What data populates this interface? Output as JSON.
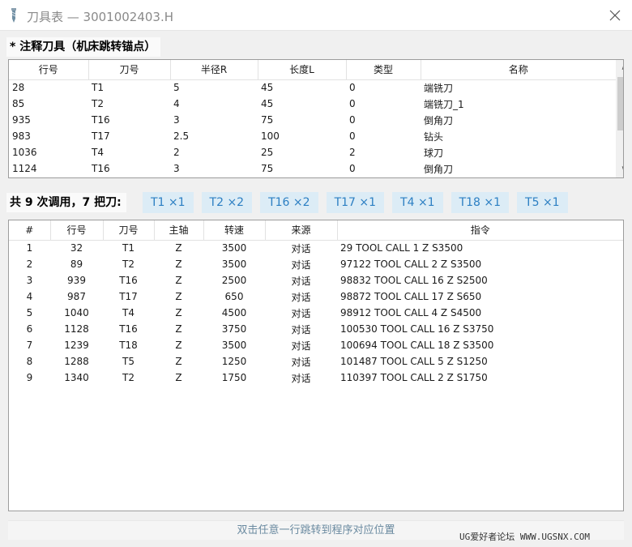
{
  "window": {
    "title": "刀具表 — 3001002403.H",
    "close_label": "×"
  },
  "annotated": {
    "label": "* 注释刀具（机床跳转锚点）",
    "columns": [
      "行号",
      "刀号",
      "半径R",
      "长度L",
      "类型",
      "名称"
    ],
    "rows": [
      [
        "28",
        "T1",
        "5",
        "45",
        "0",
        "端铣刀"
      ],
      [
        "85",
        "T2",
        "4",
        "45",
        "0",
        "端铣刀_1"
      ],
      [
        "935",
        "T16",
        "3",
        "75",
        "0",
        "倒角刀"
      ],
      [
        "983",
        "T17",
        "2.5",
        "100",
        "0",
        "钻头"
      ],
      [
        "1036",
        "T4",
        "2",
        "25",
        "2",
        "球刀"
      ],
      [
        "1124",
        "T16",
        "3",
        "75",
        "0",
        "倒角刀"
      ]
    ],
    "scroll_up": "∧",
    "scroll_down": "∨"
  },
  "summary": {
    "label": "共 9 次调用，7 把刀:",
    "chips": [
      "T1 ×1",
      "T2 ×2",
      "T16 ×2",
      "T17 ×1",
      "T4 ×1",
      "T18 ×1",
      "T5 ×1"
    ]
  },
  "calls": {
    "columns": [
      "#",
      "行号",
      "刀号",
      "主轴",
      "转速",
      "来源",
      "指令"
    ],
    "rows": [
      [
        "1",
        "32",
        "T1",
        "Z",
        "3500",
        "对话",
        "29 TOOL CALL 1 Z S3500"
      ],
      [
        "2",
        "89",
        "T2",
        "Z",
        "3500",
        "对话",
        "97122 TOOL CALL 2 Z S3500"
      ],
      [
        "3",
        "939",
        "T16",
        "Z",
        "2500",
        "对话",
        "98832 TOOL CALL 16 Z S2500"
      ],
      [
        "4",
        "987",
        "T17",
        "Z",
        "650",
        "对话",
        "98872 TOOL CALL 17 Z S650"
      ],
      [
        "5",
        "1040",
        "T4",
        "Z",
        "4500",
        "对话",
        "98912 TOOL CALL 4 Z S4500"
      ],
      [
        "6",
        "1128",
        "T16",
        "Z",
        "3750",
        "对话",
        "100530 TOOL CALL 16 Z S3750"
      ],
      [
        "7",
        "1239",
        "T18",
        "Z",
        "3500",
        "对话",
        "100694 TOOL CALL 18 Z S3500"
      ],
      [
        "8",
        "1288",
        "T5",
        "Z",
        "1250",
        "对话",
        "101487 TOOL CALL 5 Z S1250"
      ],
      [
        "9",
        "1340",
        "T2",
        "Z",
        "1750",
        "对话",
        "110397 TOOL CALL 2 Z S1750"
      ]
    ]
  },
  "status": {
    "hint": "双击任意一行跳转到程序对应位置",
    "watermark": "UG爱好者论坛 WWW.UGSNX.COM"
  },
  "icons": {
    "app": "drill-tool-icon",
    "close": "close-icon"
  },
  "colors": {
    "chip_bg": "#dcecf6",
    "chip_text": "#2c7fc3",
    "hint_text": "#6a8aa0"
  }
}
